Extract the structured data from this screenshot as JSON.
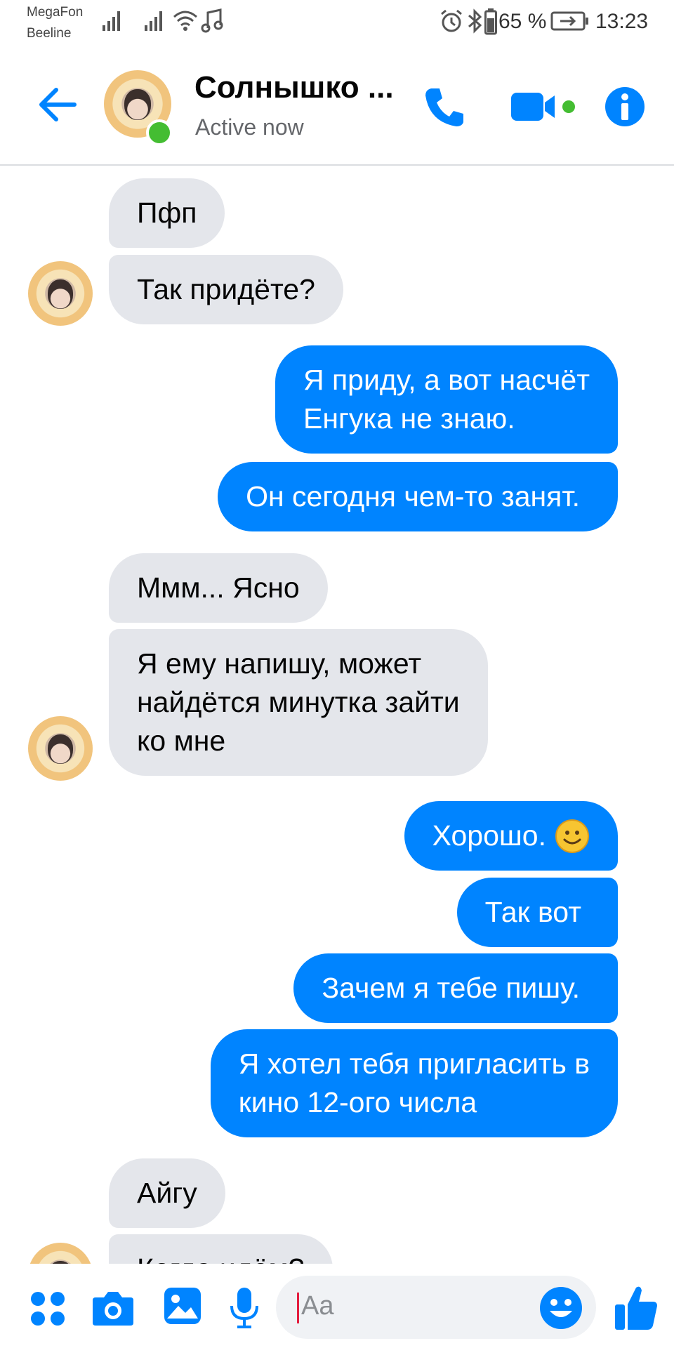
{
  "status_bar": {
    "carrier1": "MegaFon",
    "carrier2": "Beeline",
    "battery": "65 %",
    "time": "13:23"
  },
  "header": {
    "contact_name": "Солнышко ...",
    "status": "Active now",
    "accent_color": "#0084ff",
    "online_color": "#44bd32"
  },
  "messages": [
    {
      "from": "contact",
      "text": "Пфп"
    },
    {
      "from": "contact",
      "text": "Так придёте?"
    },
    {
      "from": "me",
      "text": "Я приду, а вот насчёт\nЕнгука не знаю."
    },
    {
      "from": "me",
      "text": "Он сегодня чем-то занят."
    },
    {
      "from": "contact",
      "text": "Ммм... Ясно"
    },
    {
      "from": "contact",
      "text": "Я ему напишу, может\nнайдётся минутка зайти\nко мне"
    },
    {
      "from": "me",
      "text": "Хорошо."
    },
    {
      "from": "me",
      "text": "Так вот"
    },
    {
      "from": "me",
      "text": "Зачем я тебе пишу."
    },
    {
      "from": "me",
      "text": "Я хотел тебя пригласить в\nкино 12-ого числа"
    },
    {
      "from": "contact",
      "text": "Айгу"
    },
    {
      "from": "contact",
      "text": "Когда идём?"
    }
  ],
  "composer": {
    "placeholder": "Aa",
    "icons": [
      "apps-icon",
      "camera-icon",
      "gallery-icon",
      "microphone-icon",
      "emoji-icon",
      "like-icon"
    ]
  }
}
